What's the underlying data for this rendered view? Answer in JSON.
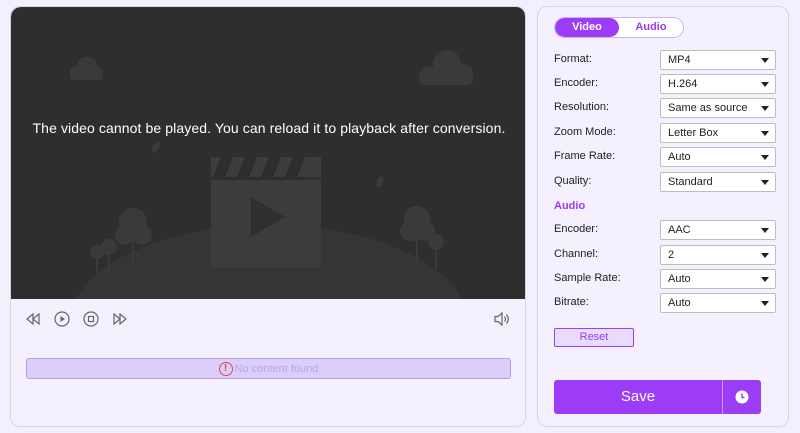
{
  "player": {
    "message": "The video cannot be played. You can reload it to playback after conversion.",
    "status_text": "No content found",
    "controls": [
      "previous-frame-icon",
      "play-icon",
      "stop-icon",
      "next-frame-icon",
      "volume-icon"
    ]
  },
  "settings": {
    "tabs": [
      {
        "label": "Video",
        "active": true
      },
      {
        "label": "Audio",
        "active": false
      }
    ],
    "video": [
      {
        "label": "Format:",
        "value": "MP4"
      },
      {
        "label": "Encoder:",
        "value": "H.264"
      },
      {
        "label": "Resolution:",
        "value": "Same as source"
      },
      {
        "label": "Zoom Mode:",
        "value": "Letter Box"
      },
      {
        "label": "Frame Rate:",
        "value": "Auto"
      },
      {
        "label": "Quality:",
        "value": "Standard"
      }
    ],
    "audio_title": "Audio",
    "audio": [
      {
        "label": "Encoder:",
        "value": "AAC"
      },
      {
        "label": "Channel:",
        "value": "2"
      },
      {
        "label": "Sample Rate:",
        "value": "Auto"
      },
      {
        "label": "Bitrate:",
        "value": "Auto"
      }
    ],
    "reset_label": "Reset",
    "save_label": "Save"
  },
  "colors": {
    "accent": "#9d3cf6",
    "background": "#f3effd",
    "video_bg": "#2e2e2e"
  }
}
